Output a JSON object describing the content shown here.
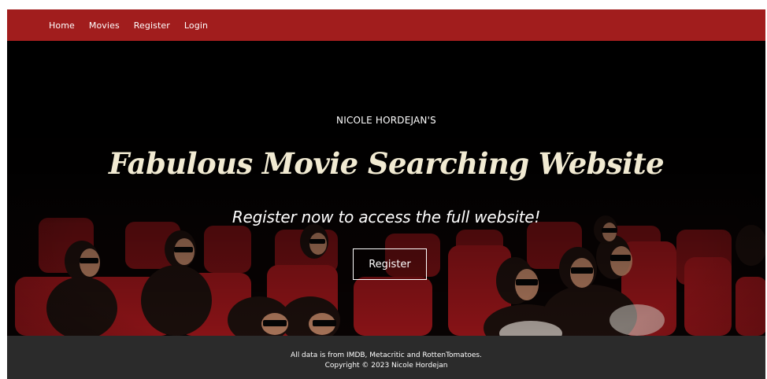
{
  "navbar": {
    "links": [
      {
        "label": "Home"
      },
      {
        "label": "Movies"
      },
      {
        "label": "Register"
      },
      {
        "label": "Login"
      }
    ],
    "background": "#a11d1d"
  },
  "hero": {
    "kicker": "NICOLE HORDEJAN'S",
    "title": "Fabulous Movie Searching Website",
    "subtitle": "Register now to access the full website!",
    "button_label": "Register",
    "title_color": "#f1ead2"
  },
  "footer": {
    "line1": "All data is from IMDB, Metacritic and RottenTomatoes.",
    "line2": "Copyright © 2023 Nicole Hordejan",
    "background": "#2b2b2b"
  }
}
